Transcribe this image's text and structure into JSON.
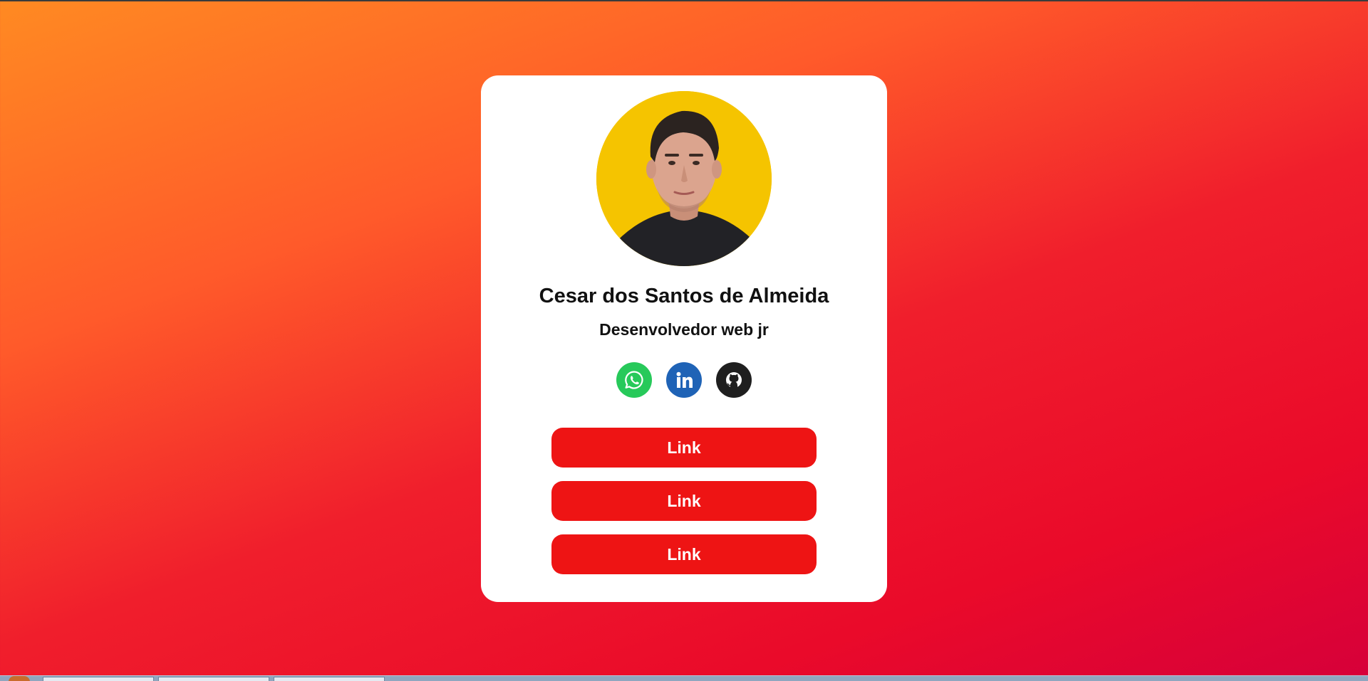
{
  "profile": {
    "name": "Cesar dos Santos de Almeida",
    "role": "Desenvolvedor web jr",
    "avatar_bg": "#f5c400"
  },
  "socials": [
    {
      "name": "whatsapp-icon",
      "color": "#27c95a"
    },
    {
      "name": "linkedin-icon",
      "color": "#1f63b6"
    },
    {
      "name": "github-icon",
      "color": "#1f1f1f"
    }
  ],
  "links": [
    {
      "label": "Link"
    },
    {
      "label": "Link"
    },
    {
      "label": "Link"
    }
  ],
  "colors": {
    "button": "#ee1414",
    "card": "#ffffff",
    "gradient_start": "#ff8a22",
    "gradient_end": "#d6003a"
  }
}
